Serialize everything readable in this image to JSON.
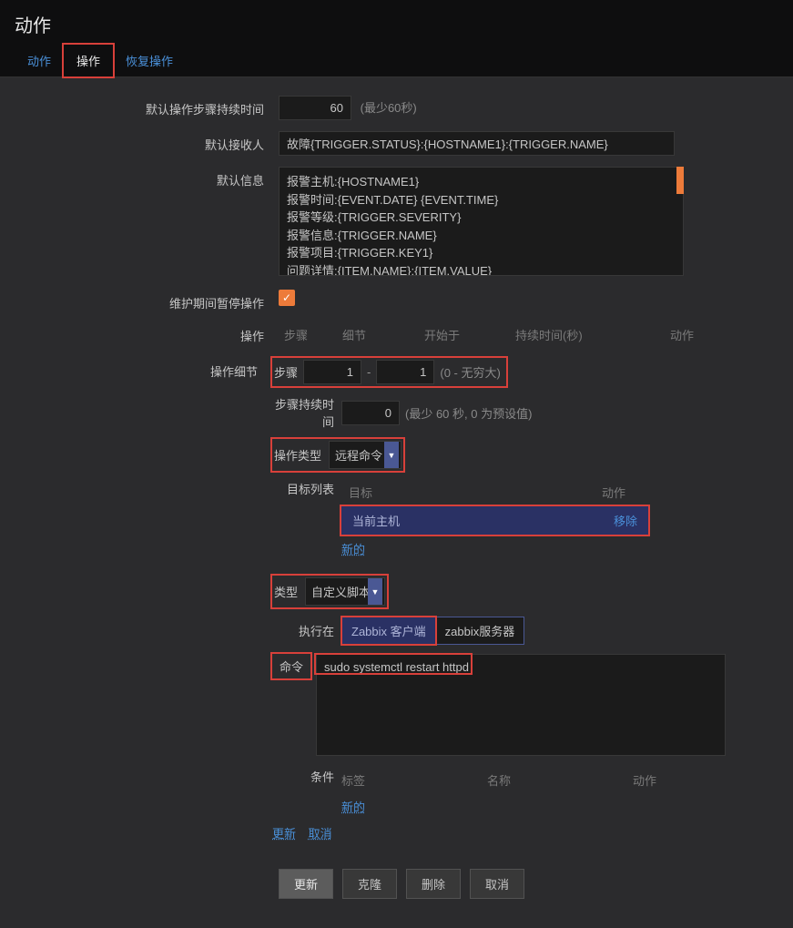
{
  "page": {
    "title": "动作"
  },
  "tabs": {
    "t1": "动作",
    "t2": "操作",
    "t3": "恢复操作"
  },
  "form": {
    "step_duration_label": "默认操作步骤持续时间",
    "step_duration_value": "60",
    "step_duration_hint": "(最少60秒)",
    "recipient_label": "默认接收人",
    "recipient_value": "故障{TRIGGER.STATUS}:{HOSTNAME1}:{TRIGGER.NAME}",
    "message_label": "默认信息",
    "message_value": "报警主机:{HOSTNAME1}\n报警时间:{EVENT.DATE} {EVENT.TIME}\n报警等级:{TRIGGER.SEVERITY}\n报警信息:{TRIGGER.NAME}\n报警项目:{TRIGGER.KEY1}\n问题详情:{ITEM.NAME}:{ITEM.VALUE}",
    "pause_label": "维护期间暂停操作",
    "operations_label": "操作",
    "ops_header": {
      "c1": "步骤",
      "c2": "细节",
      "c3": "开始于",
      "c4": "持续时间(秒)",
      "c5": "动作"
    },
    "details_label": "操作细节"
  },
  "detail": {
    "steps_label": "步骤",
    "step_from": "1",
    "step_to": "1",
    "step_hint": "(0 - 无穷大)",
    "duration_label": "步骤持续时间",
    "duration_value": "0",
    "duration_hint": "(最少 60 秒, 0 为预设值)",
    "optype_label": "操作类型",
    "optype_value": "远程命令",
    "target_label": "目标列表",
    "target_header": {
      "c1": "目标",
      "c2": "动作"
    },
    "target_item": "当前主机",
    "target_remove": "移除",
    "target_new": "新的",
    "type_label": "类型",
    "type_value": "自定义脚本",
    "exec_label": "执行在",
    "exec_opt1": "Zabbix 客户端",
    "exec_opt2": "zabbix服务器",
    "cmd_label": "命令",
    "cmd_value": "sudo systemctl restart httpd",
    "cond_label": "条件",
    "cond_header": {
      "c1": "标签",
      "c2": "名称",
      "c3": "动作"
    },
    "cond_new": "新的",
    "link_update": "更新",
    "link_cancel": "取消"
  },
  "buttons": {
    "update": "更新",
    "clone": "克隆",
    "delete": "删除",
    "cancel": "取消"
  }
}
